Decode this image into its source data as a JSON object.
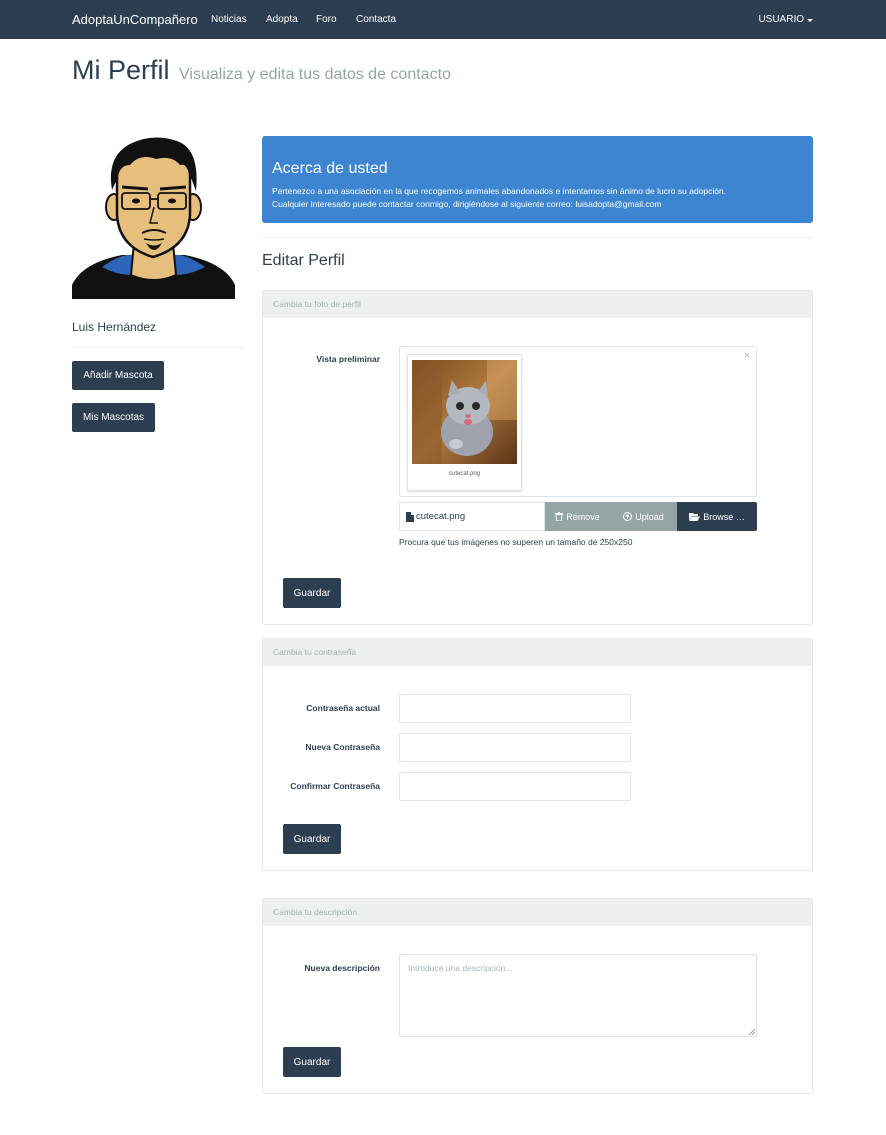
{
  "navbar": {
    "brand": "AdoptaUnCompañero",
    "links": [
      "Noticias",
      "Adopta",
      "Foro",
      "Contacta"
    ],
    "user_menu": "USUARIO"
  },
  "header": {
    "title": "Mi Perfil",
    "subtitle": "Visualiza y edita tus datos de contacto"
  },
  "sidebar": {
    "user_name": "Luis Hernández",
    "add_pet_label": "Añadir Mascota",
    "my_pets_label": "Mis Mascotas"
  },
  "about": {
    "title": "Acerca de usted",
    "text_line1": "Pertenezco a una asociación en la que recogemos animales abandonados e intentamos sin ánimo de lucro su adopción.",
    "text_line2": "Cualquier interesado puede contactar conmigo, dirigiéndose al siguiente correo: luisadopta@gmail.com"
  },
  "edit_profile": {
    "title": "Editar Perfil"
  },
  "photo_panel": {
    "heading": "Cambia tu foto de perfil",
    "preview_label": "Vista preliminar",
    "thumb_caption": "cutecat.png",
    "file_name": "cutecat.png",
    "remove_label": "Remove",
    "upload_label": "Upload",
    "browse_label": "Browse …",
    "help_text": "Procura que tus imágenes no superen un tamaño de 250x250",
    "save_label": "Guardar"
  },
  "password_panel": {
    "heading": "Cambia tu contraseña",
    "current_label": "Contraseña actual",
    "new_label": "Nueva Contraseña",
    "confirm_label": "Confirmar Contraseña",
    "save_label": "Guardar"
  },
  "description_panel": {
    "heading": "Cambia tu descripción",
    "field_label": "Nueva descripción",
    "placeholder": "Introduce una descripción...",
    "save_label": "Guardar"
  },
  "colors": {
    "navbar": "#2c3e50",
    "about_box": "#3d85d1",
    "muted_button": "#95a5a6",
    "panel_heading": "#ecf0f1"
  }
}
